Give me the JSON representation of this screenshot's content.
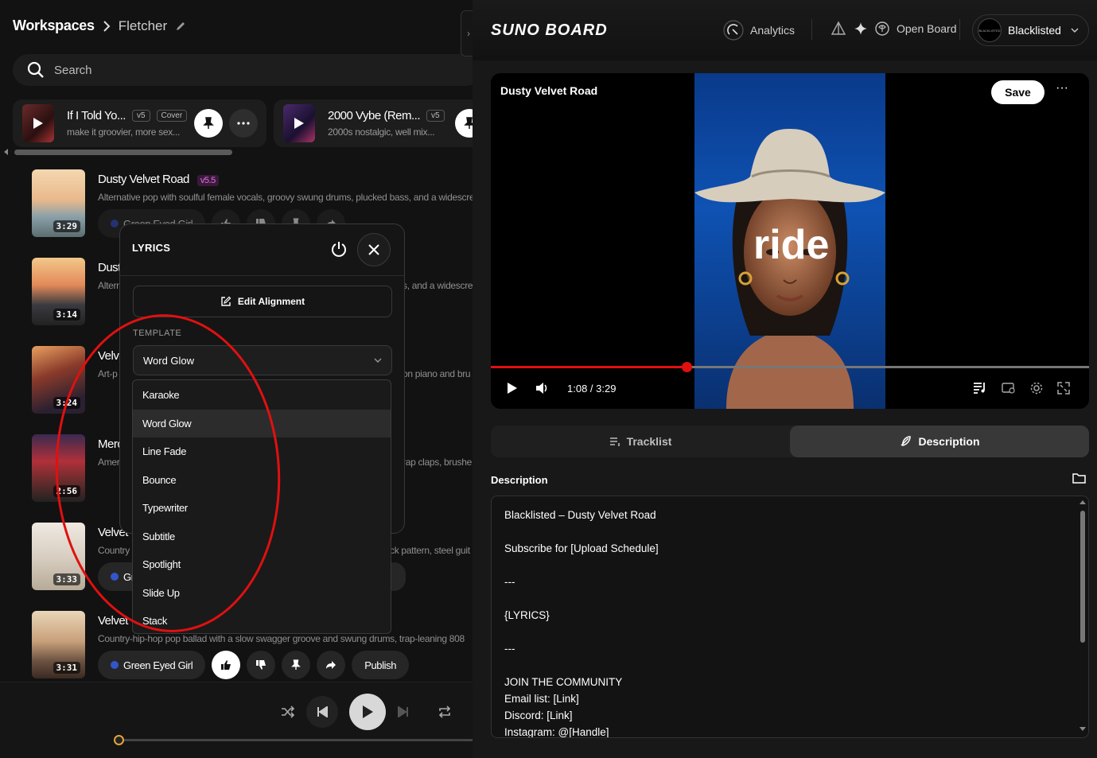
{
  "breadcrumb": {
    "root": "Workspaces",
    "current": "Fletcher"
  },
  "search": {
    "placeholder": "Search"
  },
  "cards": [
    {
      "title": "If I Told Yo...",
      "version": "v5",
      "tag": "Cover",
      "subtitle": "make it groovier, more sex..."
    },
    {
      "title": "2000 Vybe (Rem...",
      "version": "v5",
      "subtitle": "2000s nostalgic, well mix..."
    }
  ],
  "songs": [
    {
      "title": "Dusty Velvet Road",
      "version": "v5.5",
      "duration": "3:29",
      "desc": "Alternative pop with soulful female vocals, groovy swung drums, plucked bass, and a widescre",
      "artist": "Green Eyed Girl"
    },
    {
      "title": "Dust",
      "duration": "3:14",
      "desc": "Altern",
      "desc_tail": "s, and a widescre"
    },
    {
      "title": "Velv",
      "duration": "3:24",
      "desc": "Art-p",
      "desc_tail": "on piano and bru"
    },
    {
      "title": "Merc",
      "duration": "2:56",
      "desc": "Amer",
      "desc_tail": "rap claps, brushe"
    },
    {
      "title": "Velvet",
      "duration": "3:33",
      "desc": "Country",
      "desc_tail": "ck pattern, steel guit",
      "artist": "Gr"
    },
    {
      "title": "Velvet",
      "duration": "3:31",
      "desc": "Country-hip-hop pop ballad with a slow swagger groove and swung drums, trap-leaning 808",
      "artist": "Green Eyed Girl",
      "publish": "Publish"
    }
  ],
  "lyrics_panel": {
    "title": "LYRICS",
    "edit_alignment": "Edit Alignment",
    "template_label": "TEMPLATE",
    "selected": "Word Glow",
    "options": [
      "Karaoke",
      "Word Glow",
      "Line Fade",
      "Bounce",
      "Typewriter",
      "Subtitle",
      "Spotlight",
      "Slide Up",
      "Stack"
    ]
  },
  "right": {
    "brand": "SUNO BOARD",
    "nav": {
      "analytics": "Analytics",
      "open_board": "Open Board",
      "user": "Blacklisted",
      "avatar_text": "BLACKLISTED"
    },
    "video": {
      "title": "Dusty Velvet Road",
      "save": "Save",
      "overlay_word": "ride",
      "time": "1:08 / 3:29",
      "progress_fraction": 0.327
    },
    "tabs": {
      "tracklist": "Tracklist",
      "description": "Description"
    },
    "description_label": "Description",
    "description_lines": [
      "Blacklisted – Dusty Velvet Road",
      "Subscribe for [Upload Schedule]",
      "---",
      "{LYRICS}",
      "---",
      "JOIN THE COMMUNITY",
      "Email list: [Link]",
      "Discord: [Link]",
      "Instagram: @[Handle]"
    ]
  },
  "colors": {
    "accent_red": "#e01010",
    "badge_purple": "#e070e0",
    "progress_orange": "#e2a33c"
  }
}
